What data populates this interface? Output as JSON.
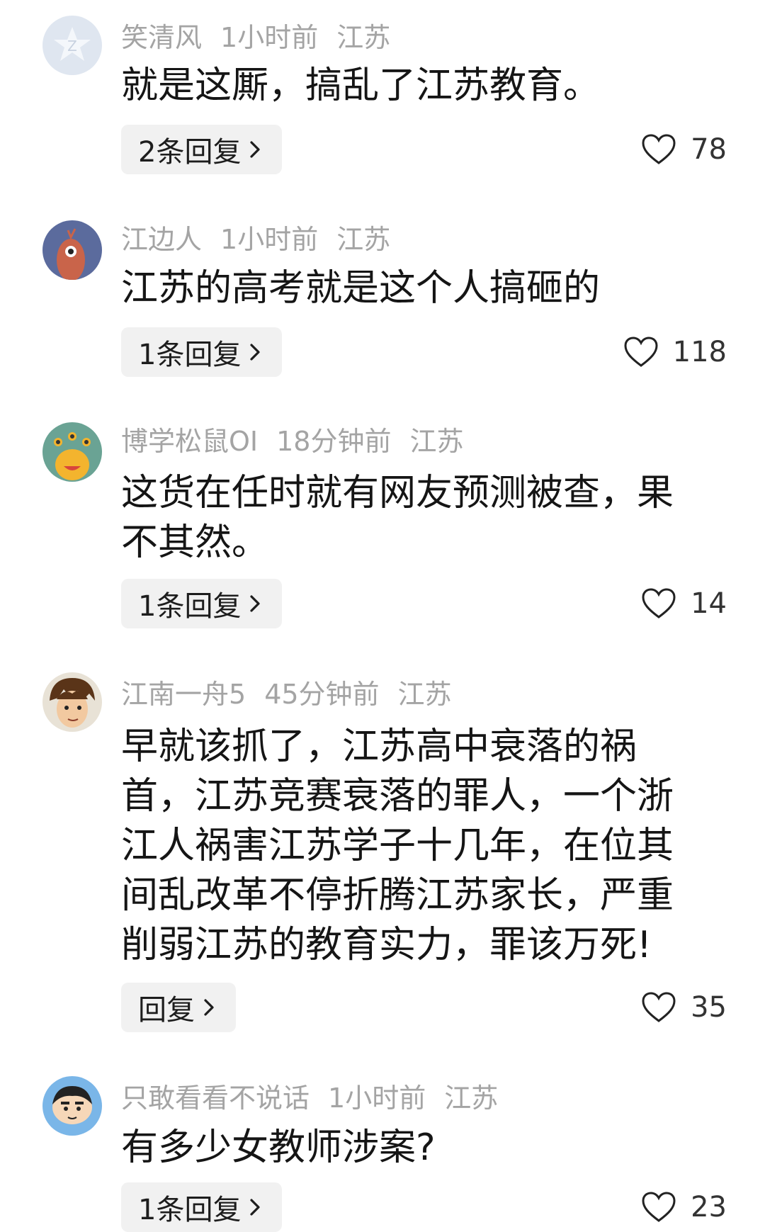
{
  "comments": [
    {
      "user": "笑清风",
      "time": "1小时前",
      "location": "江苏",
      "text": "就是这厮，搞乱了江苏教育。",
      "reply_label": "2条回复",
      "likes": "78",
      "avatar_icon": "default-qq-avatar-icon"
    },
    {
      "user": "江边人",
      "time": "1小时前",
      "location": "江苏",
      "text": "江苏的高考就是这个人搞砸的",
      "reply_label": "1条回复",
      "likes": "118",
      "avatar_icon": "cartoon-bird-avatar-icon"
    },
    {
      "user": "博学松鼠OI",
      "time": "18分钟前",
      "location": "江苏",
      "text": "这货在任时就有网友预测被查，果不其然。",
      "reply_label": "1条回复",
      "likes": "14",
      "avatar_icon": "yellow-monster-avatar-icon"
    },
    {
      "user": "江南一舟5",
      "time": "45分钟前",
      "location": "江苏",
      "text": "早就该抓了，江苏高中衰落的祸首，江苏竞赛衰落的罪人，一个浙江人祸害江苏学子十几年，在位其间乱改革不停折腾江苏家长，严重削弱江苏的教育实力，罪该万死!",
      "reply_label": "回复",
      "likes": "35",
      "avatar_icon": "anime-boy-avatar-icon"
    },
    {
      "user": "只敢看看不说话",
      "time": "1小时前",
      "location": "江苏",
      "text": "有多少女教师涉案?",
      "reply_label": "1条回复",
      "likes": "23",
      "avatar_icon": "crayon-shin-chan-avatar-icon"
    }
  ],
  "colors": {
    "meta": "#a4a4a4",
    "text": "#151515",
    "reply_bg": "#f1f1f1"
  }
}
